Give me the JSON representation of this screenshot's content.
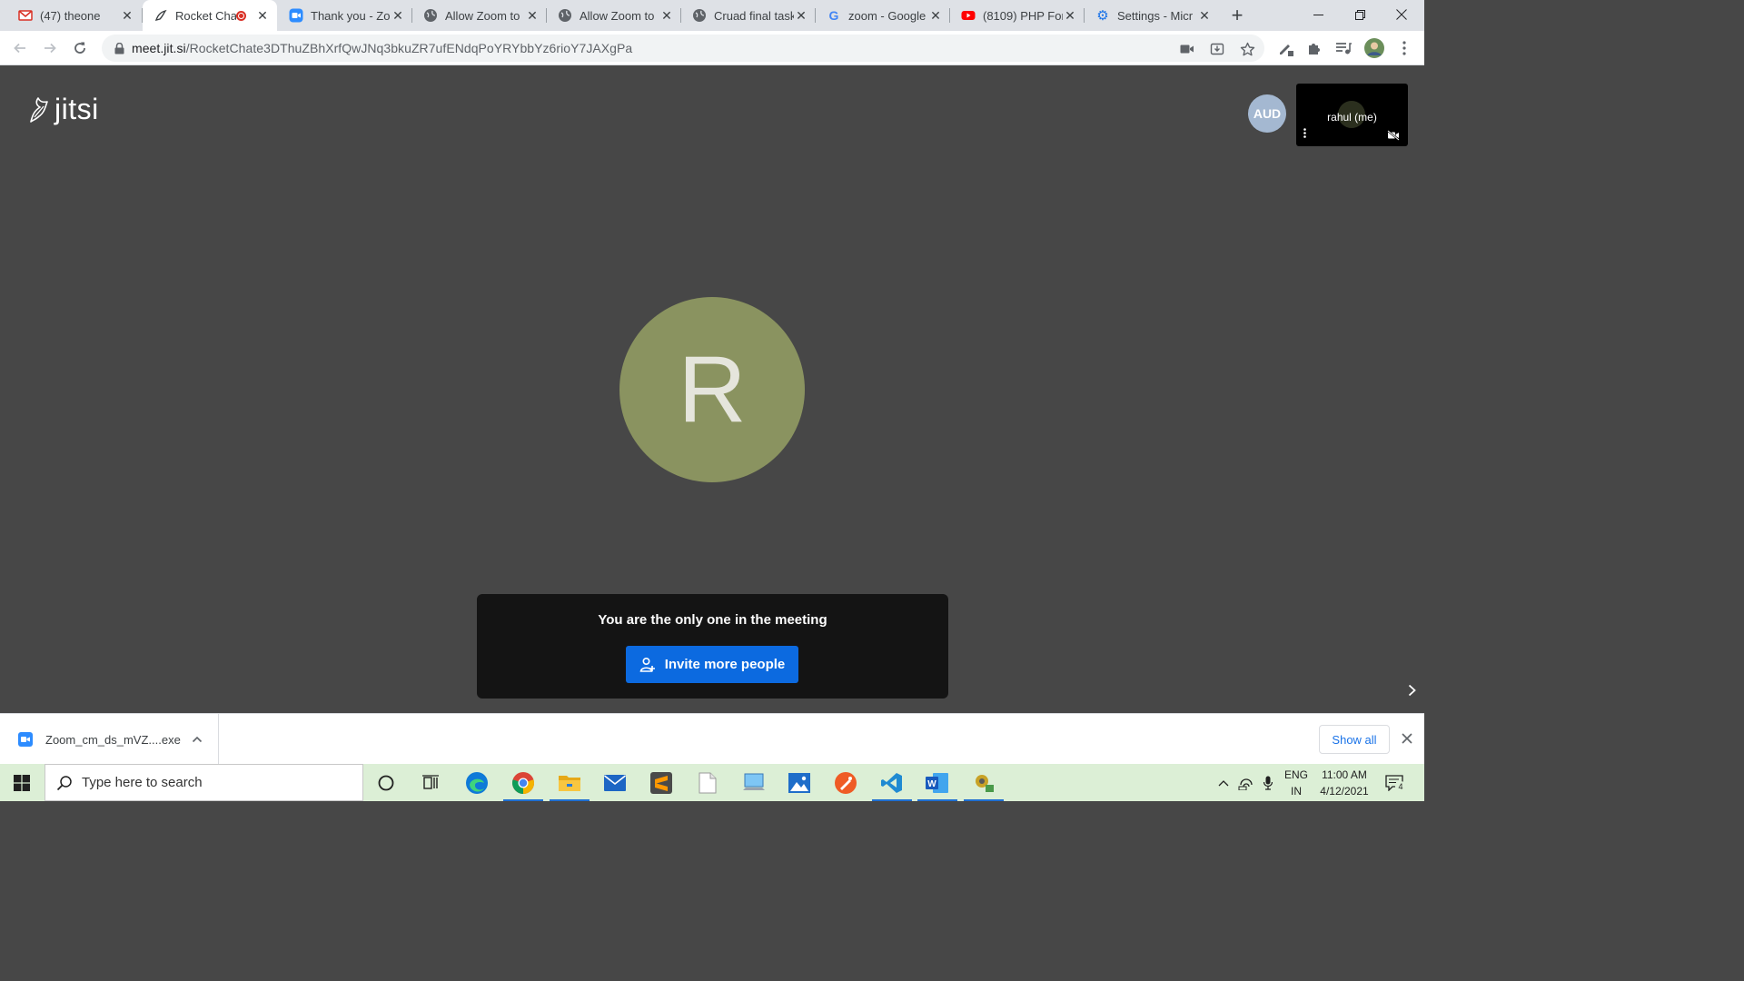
{
  "browser": {
    "tabs": [
      {
        "title": "(47) theone",
        "favicon": "gmail-badge-icon",
        "badge": "47"
      },
      {
        "title": "Rocket Cha",
        "favicon": "jitsi-icon",
        "active": true,
        "recording": true
      },
      {
        "title": "Thank you - Zo",
        "favicon": "zoom-icon"
      },
      {
        "title": "Allow Zoom to",
        "favicon": "globe-icon"
      },
      {
        "title": "Allow Zoom to",
        "favicon": "globe-icon"
      },
      {
        "title": "Cruad final task",
        "favicon": "globe-icon"
      },
      {
        "title": "zoom - Google",
        "favicon": "google-icon"
      },
      {
        "title": "(8109) PHP For",
        "favicon": "youtube-icon"
      },
      {
        "title": "Settings - Micr",
        "favicon": "gear-icon"
      }
    ],
    "url": {
      "host": "meet.jit.si",
      "path": "/RocketChate3DThuZBhXrfQwJNq3bkuZR7ufENdqPoYRYbbYz6rioY7JAXgPa"
    }
  },
  "meeting": {
    "logo_text": "jitsi",
    "remote_avatar": "AUD",
    "self_name": "rahul (me)",
    "big_avatar_letter": "R",
    "notice_text": "You are the only one in the meeting",
    "invite_label": "Invite more people"
  },
  "downloads": {
    "file_name": "Zoom_cm_ds_mVZ....exe",
    "show_all": "Show all"
  },
  "taskbar": {
    "search_placeholder": "Type here to search",
    "lang_line1": "ENG",
    "lang_line2": "IN",
    "time": "11:00 AM",
    "date": "4/12/2021",
    "notification_count": "4"
  },
  "colors": {
    "meeting_bg": "#474747",
    "avatar_bg": "#8a9360",
    "invite_button": "#0c6ae0",
    "aud_avatar": "#a4b8d1",
    "taskbar_bg": "#dcefd6"
  }
}
